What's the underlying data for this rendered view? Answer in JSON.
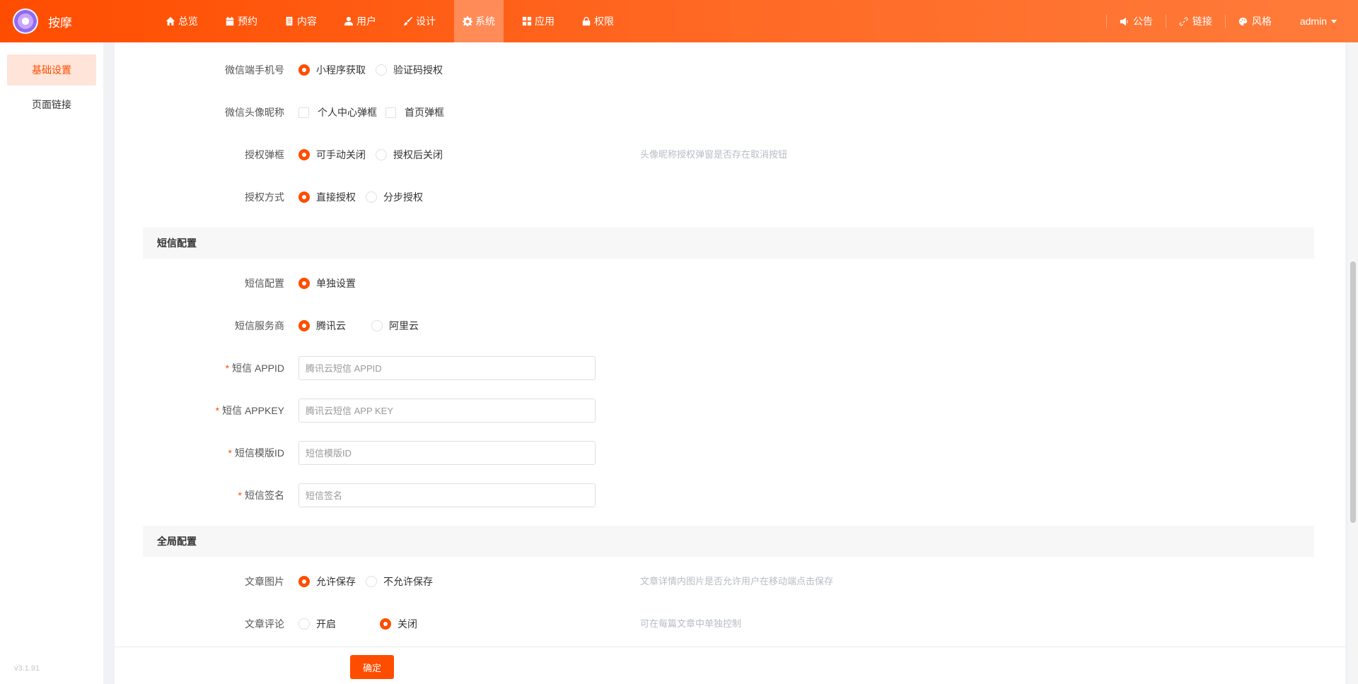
{
  "brand": {
    "name": "按摩"
  },
  "nav": [
    {
      "label": "总览",
      "icon": "home-icon",
      "active": false
    },
    {
      "label": "预约",
      "icon": "calendar-icon",
      "active": false
    },
    {
      "label": "内容",
      "icon": "document-icon",
      "active": false
    },
    {
      "label": "用户",
      "icon": "user-icon",
      "active": false
    },
    {
      "label": "设计",
      "icon": "brush-icon",
      "active": false
    },
    {
      "label": "系统",
      "icon": "gear-icon",
      "active": true
    },
    {
      "label": "应用",
      "icon": "grid-icon",
      "active": false
    },
    {
      "label": "权限",
      "icon": "lock-icon",
      "active": false
    }
  ],
  "right_menu": {
    "notice": "公告",
    "link": "链接",
    "theme": "风格",
    "user": "admin"
  },
  "sidebar": {
    "items": [
      {
        "label": "基础设置",
        "active": true
      },
      {
        "label": "页面链接",
        "active": false
      }
    ],
    "version": "v3.1.91"
  },
  "form": {
    "wechat_phone": {
      "label": "微信端手机号",
      "options": [
        "小程序获取",
        "验证码授权"
      ],
      "selected": "小程序获取"
    },
    "wechat_avatar": {
      "label": "微信头像昵称",
      "options": [
        "个人中心弹框",
        "首页弹框"
      ]
    },
    "auth_popup": {
      "label": "授权弹框",
      "options": [
        "可手动关闭",
        "授权后关闭"
      ],
      "selected": "可手动关闭",
      "hint": "头像昵称授权弹窗是否存在取消按钮"
    },
    "auth_mode": {
      "label": "授权方式",
      "options": [
        "直接授权",
        "分步授权"
      ],
      "selected": "直接授权"
    },
    "sms_section": "短信配置",
    "sms_config": {
      "label": "短信配置",
      "options": [
        "单独设置"
      ],
      "selected": "单独设置"
    },
    "sms_provider": {
      "label": "短信服务商",
      "options": [
        "腾讯云",
        "阿里云"
      ],
      "selected": "腾讯云"
    },
    "sms_appid": {
      "label": "短信 APPID",
      "placeholder": "腾讯云短信 APPID",
      "value": ""
    },
    "sms_appkey": {
      "label": "短信 APPKEY",
      "placeholder": "腾讯云短信 APP KEY",
      "value": ""
    },
    "sms_template": {
      "label": "短信模版ID",
      "placeholder": "短信模版ID",
      "value": ""
    },
    "sms_sign": {
      "label": "短信签名",
      "placeholder": "短信签名",
      "value": ""
    },
    "global_section": "全局配置",
    "article_image": {
      "label": "文章图片",
      "options": [
        "允许保存",
        "不允许保存"
      ],
      "selected": "允许保存",
      "hint": "文章详情内图片是否允许用户在移动端点击保存"
    },
    "article_comment": {
      "label": "文章评论",
      "options": [
        "开启",
        "关闭"
      ],
      "selected": "关闭",
      "hint": "可在每篇文章中单独控制"
    },
    "required_mark": "*"
  },
  "footer": {
    "confirm": "确定"
  },
  "colors": {
    "accent": "#ff4d00",
    "active_bg": "#ffe4d9",
    "section_bg": "#f7f7f7",
    "hint": "#b7bcc6"
  }
}
